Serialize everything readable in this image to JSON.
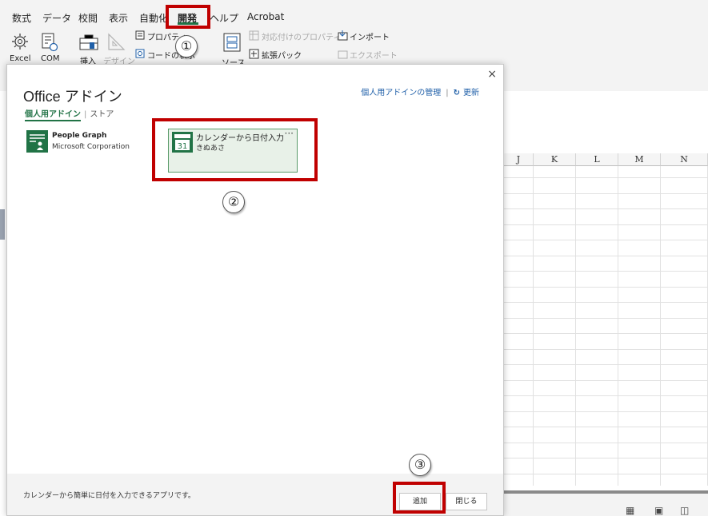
{
  "menu": {
    "tabs": [
      "数式",
      "データ",
      "校閲",
      "表示",
      "自動化",
      "開発",
      "ヘルプ",
      "Acrobat"
    ],
    "active_tab": "開発"
  },
  "ribbon": {
    "excel_label": "Excel",
    "com_label": "COM",
    "insert_label": "挿入",
    "design_label": "デザイン",
    "properties_label": "プロパティ",
    "view_code_label": "コードの表示",
    "source_label": "ソース",
    "map_properties_label": "対応付けのプロパティ",
    "expansion_pack_label": "拡張パック",
    "import_label": "インポート",
    "export_label": "エクスポート"
  },
  "sheet": {
    "columns": [
      "J",
      "K",
      "L",
      "M",
      "N"
    ]
  },
  "dialog": {
    "title": "Office アドイン",
    "close": "×",
    "manage_link": "個人用アドインの管理",
    "separator": "|",
    "refresh_icon": "↻",
    "refresh_label": "更新",
    "subtabs": {
      "active": "個人用アドイン",
      "separator": "|",
      "store": "ストア"
    },
    "addins": [
      {
        "name": "People Graph",
        "publisher": "Microsoft Corporation",
        "icon": "people-graph-icon"
      },
      {
        "name": "カレンダーから日付入力",
        "publisher": "きぬあさ",
        "icon": "calendar-icon",
        "icon_text": "31",
        "more": "···",
        "selected": true
      }
    ],
    "footer": {
      "description": "カレンダーから簡単に日付を入力できるアプリです。",
      "add_button": "追加",
      "close_button": "閉じる"
    }
  },
  "annotations": {
    "step1": "①",
    "step2": "②",
    "step3": "③",
    "highlight_color": "#c00000"
  },
  "colors": {
    "accent": "#217346",
    "link": "#1f5fa8"
  }
}
